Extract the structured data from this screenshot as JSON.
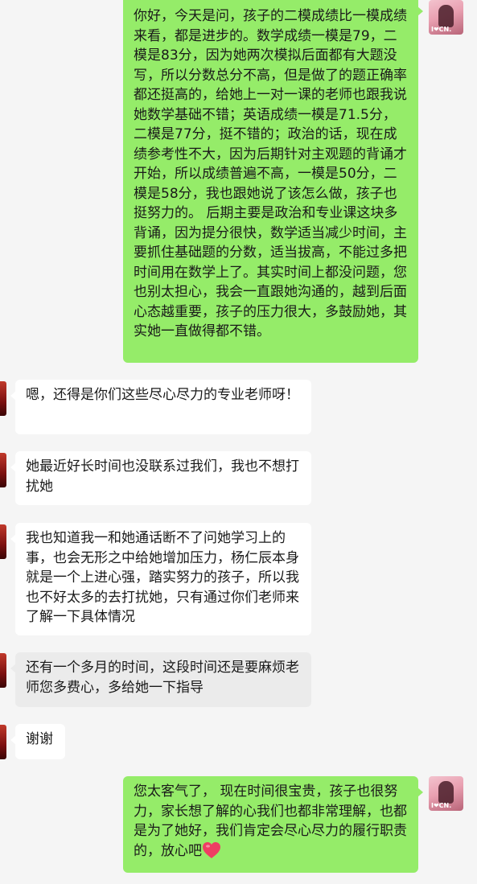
{
  "messages": [
    {
      "id": "m1",
      "side": "out",
      "text": "你好，今天是问，孩子的二模成绩比一模成绩来看，都是进步的。数学成绩一模是79，二模是83分，因为她两次模拟后面都有大题没写，所以分数总分不高，但是做了的题正确率都还挺高的，给她上一对一课的老师也跟我说她数学基础不错；英语成绩一模是71.5分，二模是77分，挺不错的；政治的话，现在成绩参考性不大，因为后期针对主观题的背诵才开始，所以成绩普遍不高，一模是50分，二模是58分，我也跟她说了该怎么做，孩子也挺努力的。 后期主要是政治和专业课这块多背诵，因为提分很快，数学适当减少时间，主要抓住基础题的分数，适当拔高，不能过多把时间用在数学上了。其实时间上都没问题，您也别太担心，我会一直跟她沟通的，越到后面心态越重要，孩子的压力很大，多鼓励她，其实她一直做得都不错。"
    },
    {
      "id": "m2",
      "side": "in",
      "text": "嗯，还得是你们这些尽心尽力的专业老师呀！"
    },
    {
      "id": "m3",
      "side": "in",
      "text": "她最近好长时间也没联系过我们，我也不想打扰她"
    },
    {
      "id": "m4",
      "side": "in",
      "text": "我也知道我一和她通话断不了问她学习上的事，也会无形之中给她增加压力，杨仁辰本身就是一个上进心强，踏实努力的孩子，所以我也不好太多的去打扰她，只有通过你们老师来了解一下具体情况"
    },
    {
      "id": "m5",
      "side": "in",
      "text": "还有一个多月的时间，这段时间还是要麻烦老师您多费心，多给她一下指导"
    },
    {
      "id": "m6",
      "side": "in",
      "text": "谢谢"
    },
    {
      "id": "m7",
      "side": "out",
      "text": "您太客气了，  现在时间很宝贵，孩子也很努力，家长想了解的心我们也都非常理解，也都是为了她好，我们肯定会尽心尽力的履行职责的，放心吧"
    }
  ],
  "avatar_me": {
    "tag": "I❤CN."
  },
  "icons": {
    "heart": "heart-emoji-icon"
  },
  "colors": {
    "outgoing": "#95ec69",
    "incoming": "#ffffff",
    "background": "#f5f5f5"
  }
}
